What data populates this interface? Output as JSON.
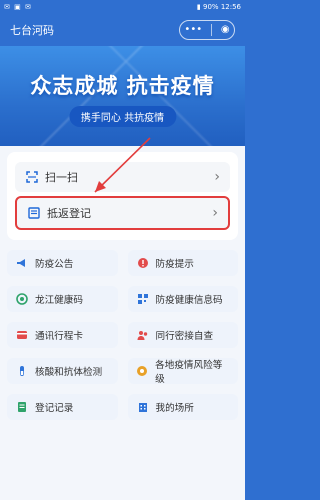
{
  "status_bar": {
    "left_icons": [
      "wechat-icon",
      "image-icon",
      "message-icon"
    ],
    "right_text": "90%",
    "time": "12:56"
  },
  "navbar": {
    "title": "七台河码",
    "more": "•••"
  },
  "banner": {
    "slogan": "众志成城   抗击疫情",
    "pill": "携手同心  共抗疫情"
  },
  "card": {
    "items": [
      {
        "label": "扫一扫",
        "icon": "scan-icon"
      },
      {
        "label": "抵返登记",
        "icon": "register-icon"
      }
    ]
  },
  "tiles": [
    {
      "label": "防疫公告",
      "icon": "megaphone-icon",
      "color": "#2f74d9"
    },
    {
      "label": "防疫提示",
      "icon": "tip-icon",
      "color": "#e24b4b"
    },
    {
      "label": "龙江健康码",
      "icon": "health-code-icon",
      "color": "#2fa36b"
    },
    {
      "label": "防疫健康信息码",
      "icon": "info-code-icon",
      "color": "#2f74d9"
    },
    {
      "label": "通讯行程卡",
      "icon": "card-icon",
      "color": "#e24b4b"
    },
    {
      "label": "同行密接自查",
      "icon": "contact-icon",
      "color": "#e24b4b"
    },
    {
      "label": "核酸和抗体检测",
      "icon": "test-icon",
      "color": "#2f74d9"
    },
    {
      "label": "各地疫情风险等级",
      "icon": "risk-icon",
      "color": "#e8a128"
    },
    {
      "label": "登记记录",
      "icon": "record-icon",
      "color": "#2fa36b"
    },
    {
      "label": "我的场所",
      "icon": "building-icon",
      "color": "#2f74d9"
    }
  ]
}
